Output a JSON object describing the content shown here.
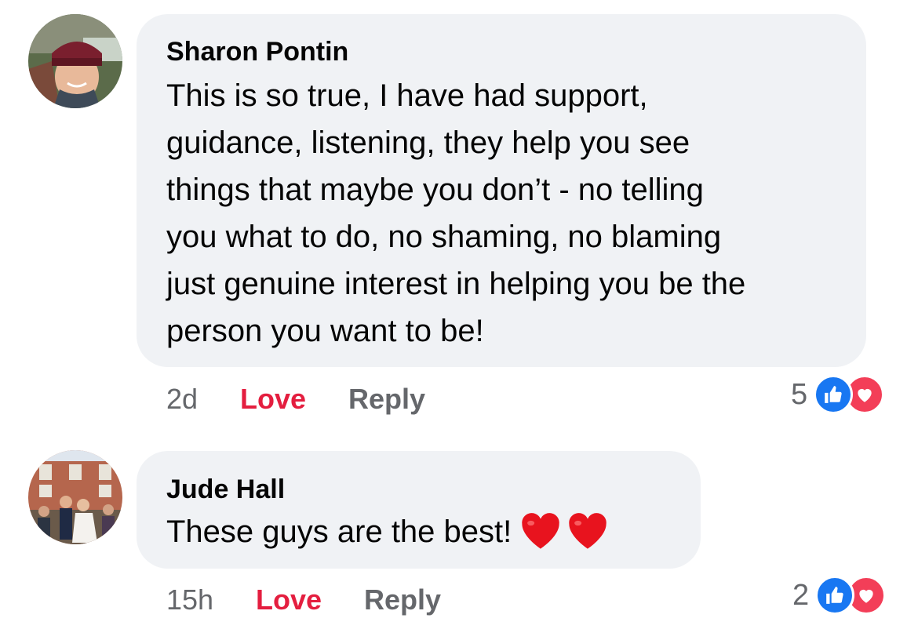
{
  "comments": [
    {
      "author": "Sharon Pontin",
      "text_lines": [
        "This is so true, I have had support,",
        "guidance, listening, they help you see",
        "things that maybe you don’t - no telling",
        "you what to do, no shaming, no blaming",
        "just genuine interest in helping you be the",
        "person you want to be!"
      ],
      "avatar_icon": "profile-photo-woman-red-beanie",
      "time": "2d",
      "love_label": "Love",
      "reply_label": "Reply",
      "reaction_count": "5",
      "reaction_icons": [
        "like-icon",
        "love-icon"
      ]
    },
    {
      "author": "Jude Hall",
      "text_lines": [
        "These guys are the best!"
      ],
      "emoji": [
        "heart-emoji",
        "heart-emoji"
      ],
      "avatar_icon": "profile-photo-wedding-group",
      "time": "15h",
      "love_label": "Love",
      "reply_label": "Reply",
      "reaction_count": "2",
      "reaction_icons": [
        "like-icon",
        "love-icon"
      ]
    }
  ],
  "colors": {
    "bubble": "#f0f2f5",
    "love_text": "#e41e3f",
    "secondary_text": "#65676b",
    "like_blue": "#1877f2",
    "love_red": "#f33e58"
  }
}
